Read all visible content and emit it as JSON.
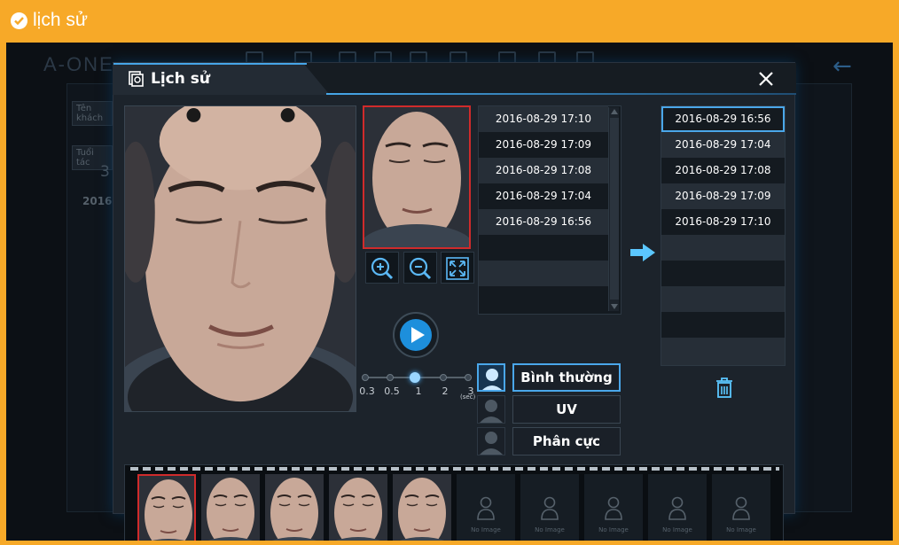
{
  "banner": {
    "title": "lịch sử"
  },
  "background": {
    "logo": "A-ONE",
    "fields": [
      "Tên khách",
      "Tuổi tác"
    ],
    "age": "3",
    "date_prefix": "2016"
  },
  "dialog": {
    "title": "Lịch sử",
    "close": "close",
    "left_list": [
      "2016-08-29 17:10",
      "2016-08-29 17:09",
      "2016-08-29 17:08",
      "2016-08-29 17:04",
      "2016-08-29 16:56"
    ],
    "right_list": [
      "2016-08-29 16:56",
      "2016-08-29 17:04",
      "2016-08-29 17:08",
      "2016-08-29 17:09",
      "2016-08-29 17:10"
    ],
    "right_selected": 0,
    "speeds": [
      "0.3",
      "0.5",
      "1",
      "2",
      "3"
    ],
    "speed_unit": "(sec)",
    "speed_selected": 2,
    "modes": [
      {
        "label": "Bình thường",
        "active": true
      },
      {
        "label": "UV",
        "active": false
      },
      {
        "label": "Phân cực",
        "active": false
      }
    ],
    "tools": [
      "zoom-in",
      "zoom-out",
      "fit-screen"
    ],
    "filmstrip": {
      "image_frames": 5,
      "empty_frames": 5,
      "empty_label": "No Image"
    }
  },
  "colors": {
    "accent": "#4aa7ea",
    "highlight": "#d02b2b",
    "banner": "#f7a928"
  }
}
